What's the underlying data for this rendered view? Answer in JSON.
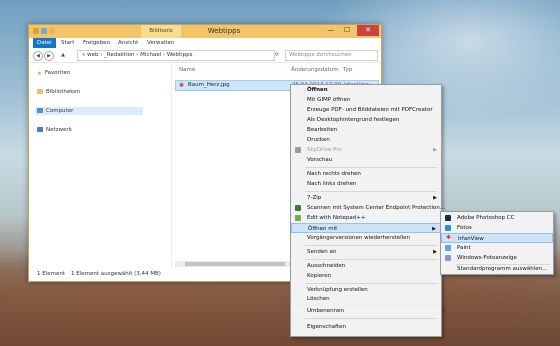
{
  "window": {
    "title": "Webtipps",
    "tools_tab": "Bildtools",
    "controls": {
      "minimize": "—",
      "maximize": "☐",
      "close": "✕"
    }
  },
  "ribbon": {
    "tabs": [
      "Datei",
      "Start",
      "Freigeben",
      "Ansicht",
      "Verwalten"
    ]
  },
  "nav": {
    "back": "◀",
    "forward": "▶",
    "up": "▲",
    "refresh": "⟳",
    "address": "«  web  ›  _Redaktion  ›  Michael  ›  Webtipps",
    "search_placeholder": "Webtipps durchsuchen"
  },
  "sidebar": {
    "items": [
      {
        "label": "Favoriten",
        "icon": "star-icon"
      },
      {
        "label": "Bibliotheken",
        "icon": "library-icon"
      },
      {
        "label": "Computer",
        "icon": "computer-icon"
      },
      {
        "label": "Netzwerk",
        "icon": "network-icon"
      }
    ]
  },
  "columns": {
    "name": "Name",
    "date": "Änderungsdatum",
    "type": "Typ"
  },
  "file": {
    "name": "Baum_Herz.jpg",
    "date": "25.04.2014 17:30",
    "type": "IrfanView"
  },
  "status": {
    "count": "1 Element",
    "selected": "1 Element ausgewählt (3,44 MB)"
  },
  "context_menu": {
    "groups": [
      [
        "Öffnen",
        "Mit GIMP öffnen",
        "Erzeuge PDF- und Bilddateien mit PDFCreator",
        "Als Desktophintergrund festlegen",
        "Bearbeiten",
        "Drucken",
        "SkyDrive Pro",
        "Vorschau"
      ],
      [
        "Nach rechts drehen",
        "Nach links drehen"
      ],
      [
        "7-Zip",
        "Scannen mit System Center Endpoint Protection...",
        "Edit with Notepad++",
        "Öffnen mit",
        "Vorgängerversionen wiederherstellen"
      ],
      [
        "Senden an"
      ],
      [
        "Ausschneiden",
        "Kopieren"
      ],
      [
        "Verknüpfung erstellen",
        "Löschen",
        "Umbenennen"
      ],
      [
        "Eigenschaften"
      ]
    ]
  },
  "submenu": {
    "items": [
      "Adobe Photoshop CC",
      "Fotos",
      "IrfanView",
      "Paint",
      "Windows-Fotoanzeige"
    ],
    "footer": "Standardprogramm auswählen..."
  },
  "colors": {
    "accent": "#1a74c4",
    "titlebar": "#f3c56a",
    "highlight": "#cfe3f7",
    "close": "#c7453c"
  }
}
